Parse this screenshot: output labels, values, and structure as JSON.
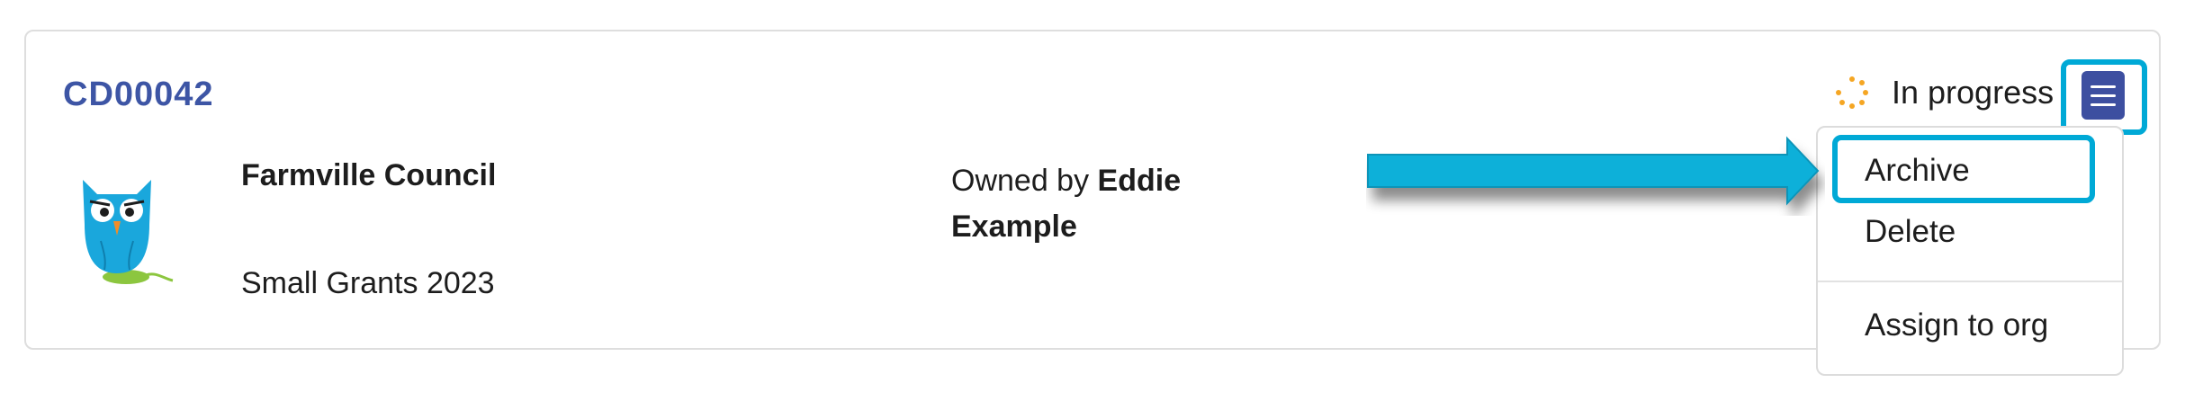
{
  "record": {
    "reference": "CD00042",
    "organisation": "Farmville Council",
    "program": "Small Grants 2023",
    "owner_prefix": "Owned by",
    "owner_name": "Eddie Example",
    "status": "In progress"
  },
  "menu": {
    "button_icon": "hamburger-menu-icon",
    "items": [
      {
        "label": "Archive"
      },
      {
        "label": "Delete"
      },
      {
        "label": "Assign to org"
      }
    ]
  },
  "icons": {
    "logo": "owl-logo-icon",
    "status": "spinner-icon",
    "annotation": "arrow-icon"
  },
  "colors": {
    "reference": "#3d55a5",
    "menu_button": "#3d4fa0",
    "highlight": "#00a9d6",
    "spinner": "#f5a623"
  }
}
